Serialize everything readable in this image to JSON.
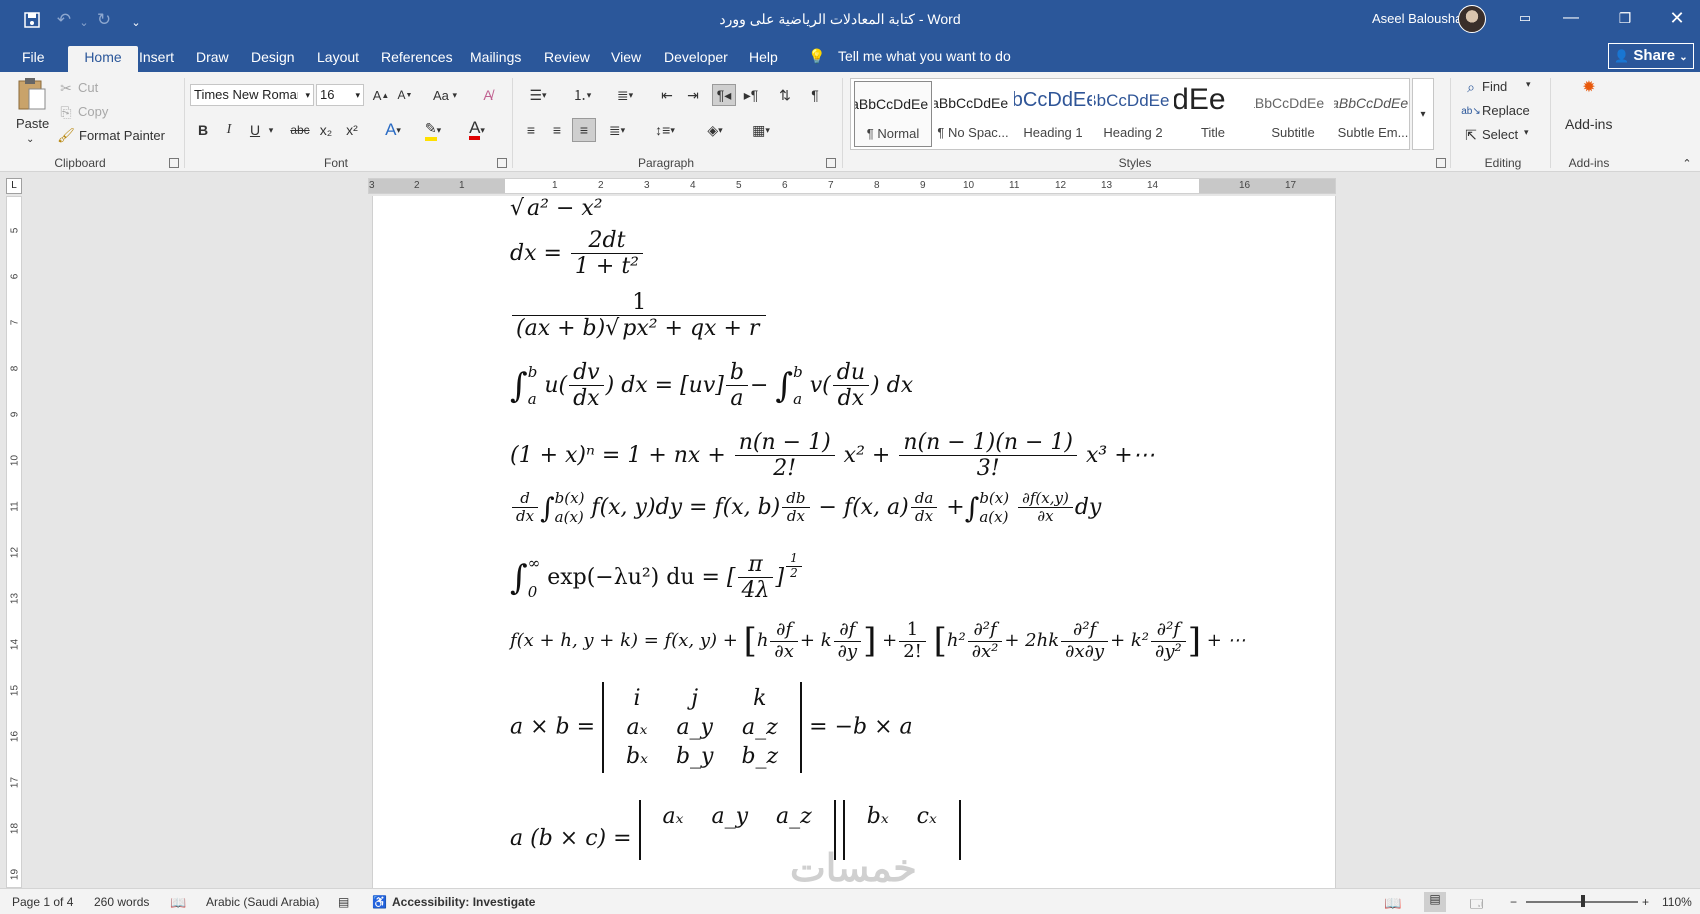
{
  "titlebar": {
    "title": "كتابة المعادلات الرياضية على وورد  -  Word",
    "user": "Aseel Balousha",
    "quick_access": {
      "save_icon": "save-icon",
      "undo_icon": "undo-icon",
      "redo_icon": "redo-icon",
      "customize_icon": "chevron-down-icon"
    },
    "accent": "#2b579a"
  },
  "tabs": [
    "File",
    "Home",
    "Insert",
    "Draw",
    "Design",
    "Layout",
    "References",
    "Mailings",
    "Review",
    "View",
    "Developer",
    "Help"
  ],
  "active_tab": "Home",
  "tell_me": "Tell me what you want to do",
  "share": "Share",
  "clipboard": {
    "paste": "Paste",
    "cut": "Cut",
    "copy": "Copy",
    "format_painter": "Format Painter",
    "label": "Clipboard"
  },
  "font": {
    "name": "Times New Roman",
    "size": "16",
    "label": "Font",
    "buttons": [
      "B",
      "I",
      "U",
      "abc",
      "x₂",
      "x²"
    ],
    "case": "Aa"
  },
  "paragraph": {
    "label": "Paragraph",
    "pilcrow": "¶"
  },
  "styles": {
    "label": "Styles",
    "items": [
      {
        "preview": "AaBbCcDdEe",
        "name": "¶ Normal"
      },
      {
        "preview": "AaBbCcDdEe",
        "name": "¶ No Spac..."
      },
      {
        "preview": "AaBbCcDdEe",
        "name": "Heading 1"
      },
      {
        "preview": "AaBbCcDdEe",
        "name": "Heading 2"
      },
      {
        "preview": "AaBbCcDdEe",
        "name": "Title"
      },
      {
        "preview": "AaBbCcDdEe",
        "name": "Subtitle"
      },
      {
        "preview": "AaBbCcDdEe",
        "name": "Subtle Em..."
      }
    ]
  },
  "editing": {
    "find": "Find",
    "replace": "Replace",
    "select": "Select",
    "label": "Editing"
  },
  "addins": {
    "button": "Add-ins",
    "label": "Add-ins"
  },
  "ruler": {
    "h_labels": [
      "3",
      "2",
      "1",
      "1",
      "2",
      "3",
      "4",
      "5",
      "6",
      "7",
      "8",
      "9",
      "10",
      "11",
      "12",
      "13",
      "14",
      "16",
      "17"
    ],
    "v_labels": [
      "5",
      "6",
      "7",
      "8",
      "9",
      "10",
      "11",
      "12",
      "13",
      "14",
      "15",
      "16",
      "17",
      "18",
      "19"
    ],
    "corner": "L"
  },
  "equations": {
    "e1": {
      "sqrt_body": "a² − x²"
    },
    "e2": {
      "lhs": "dx =",
      "num": "2dt",
      "den": "1 + t²"
    },
    "e3": {
      "num": "1",
      "den_a": "(ax + b)",
      "den_b": "px² + qx + r"
    },
    "e4": {
      "int_sym": "∫",
      "up": "b",
      "lo": "a",
      "u": "u",
      "f1_num": "dv",
      "f1_den": "dx",
      "mid": "dx = [uv]",
      "f2_num": "b",
      "f2_den": "a",
      "minus": "−",
      "v": "v",
      "f3_num": "du",
      "f3_den": "dx",
      "end": "dx"
    },
    "e5": {
      "a": "(1 + x)ⁿ = 1 + nx +",
      "f1_num": "n(n − 1)",
      "f1_den": "2!",
      "b": "x² +",
      "f2_num": "n(n − 1)(n − 1)",
      "f2_den": "3!",
      "c": "x³ +⋯"
    },
    "e6": {
      "d_num": "d",
      "d_den": "dx",
      "up1": "b(x)",
      "lo1": "a(x)",
      "a": "f(x, y)dy = f(x, b)",
      "db_num": "db",
      "db_den": "dx",
      "b": "− f(x, a)",
      "da_num": "da",
      "da_den": "dx",
      "c": "+",
      "up2": "b(x)",
      "lo2": "a(x)",
      "pf_num": "∂f(x,y)",
      "pf_den": "∂x",
      "end": "dy"
    },
    "e7": {
      "up": "∞",
      "lo": "0",
      "a": "exp(−λu²) du =",
      "num": "π",
      "den": "4λ",
      "exp_num": "1",
      "exp_den": "2"
    },
    "e8": {
      "a": "f(x + h, y + k) = f(x, y) +",
      "h": "h",
      "p1_num": "∂f",
      "p1_den": "∂x",
      "k1": "+ k",
      "p2_num": "∂f",
      "p2_den": "∂y",
      "plus": "+",
      "h_num": "1",
      "h_den": "2!",
      "h2": "h²",
      "p3_num": "∂²f",
      "p3_den": "∂x²",
      "hk": "+ 2hk",
      "p4_num": "∂²f",
      "p4_den": "∂x∂y",
      "k2": "+ k²",
      "p5_num": "∂²f",
      "p5_den": "∂y²",
      "end": "+ ⋯"
    },
    "e9": {
      "lhs": "a × b =",
      "rows": [
        [
          "i",
          "j",
          "k"
        ],
        [
          "aₓ",
          "a_y",
          "a_z"
        ],
        [
          "bₓ",
          "b_y",
          "b_z"
        ]
      ],
      "rhs": "= −b × a"
    },
    "e10": {
      "lhs": "a (b × c) =",
      "r1": [
        "aₓ",
        "a_y",
        "a_z"
      ],
      "r2": [
        "bₓ",
        "cₓ"
      ]
    }
  },
  "status": {
    "page": "Page 1 of 4",
    "words": "260 words",
    "language": "Arabic (Saudi Arabia)",
    "accessibility": "Accessibility: Investigate",
    "zoom": "110%",
    "zoom_out": "−",
    "zoom_in": "+"
  },
  "watermark": "خمسات"
}
